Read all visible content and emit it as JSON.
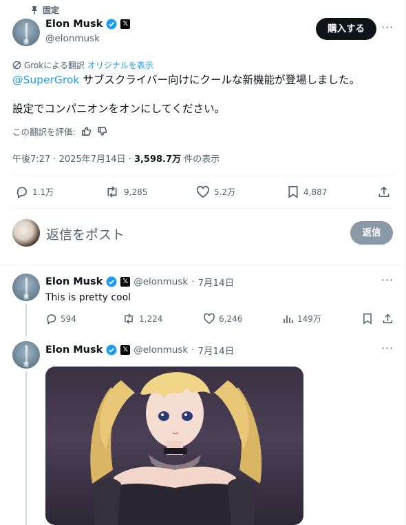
{
  "pinned": {
    "label": "固定"
  },
  "main_tweet": {
    "author_name": "Elon Musk",
    "handle": "@elonmusk",
    "subscribe_label": "購入する",
    "translation_note": "Grokによる翻訳",
    "show_original": "オリジナルを表示",
    "mention": "@SuperGrok",
    "text_line1": " サブスクライバー向けにクールな新機能が登場しました。",
    "text_line2": "設定でコンパニオンをオンにしてください。",
    "rate_translation": "この翻訳を評価:",
    "time": "午後7:27",
    "date": "2025年7月14日",
    "views": "3,598.7万",
    "views_suffix": "件の表示",
    "replies": "1.1万",
    "reposts": "9,285",
    "likes": "5.2万",
    "bookmarks": "4,887"
  },
  "compose": {
    "placeholder": "返信をポスト",
    "reply_button": "返信"
  },
  "reply1": {
    "author_name": "Elon Musk",
    "handle": "@elonmusk",
    "date": "7月14日",
    "text": "This is pretty cool",
    "replies": "594",
    "reposts": "1,224",
    "likes": "6,246",
    "views": "149万"
  },
  "reply2": {
    "author_name": "Elon Musk",
    "handle": "@elonmusk",
    "date": "7月14日"
  },
  "separator": "·",
  "colors": {
    "accent": "#1d9bf0",
    "text": "#0f1419",
    "muted": "#536471",
    "divider": "#eff3f4"
  }
}
